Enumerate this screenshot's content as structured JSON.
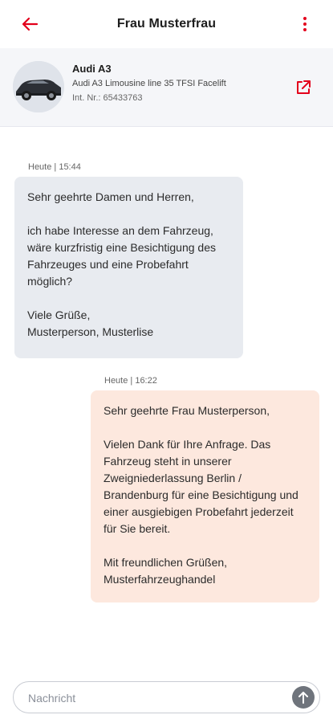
{
  "header": {
    "title": "Frau Musterfrau",
    "back_icon": "arrow-left-icon",
    "menu_icon": "more-vertical-icon",
    "accent_color": "#e3001b"
  },
  "vehicle": {
    "name": "Audi A3",
    "model": "Audi A3 Limousine line 35 TFSI Facelift",
    "internal_number": "Int. Nr.: 65433763",
    "open_icon": "external-link-icon"
  },
  "messages": [
    {
      "direction": "incoming",
      "timestamp": "Heute | 15:44",
      "text": "Sehr geehrte Damen und Herren,\n\nich habe Interesse an dem Fahrzeug, wäre kurzfristig eine Besichtigung des Fahrzeuges und eine Probefahrt möglich?\n\nViele Grüße,\nMusterperson, Musterlise"
    },
    {
      "direction": "outgoing",
      "timestamp": "Heute | 16:22",
      "text": "Sehr geehrte Frau Musterperson,\n\nVielen Dank für Ihre Anfrage. Das Fahrzeug steht in unserer Zweigniederlassung Berlin / Brandenburg für eine Besichtigung und einer ausgiebigen Probefahrt jederzeit für Sie bereit.\n\nMit freundlichen Grüßen,\nMusterfahrzeughandel"
    }
  ],
  "composer": {
    "placeholder": "Nachricht",
    "send_icon": "arrow-up-icon"
  }
}
